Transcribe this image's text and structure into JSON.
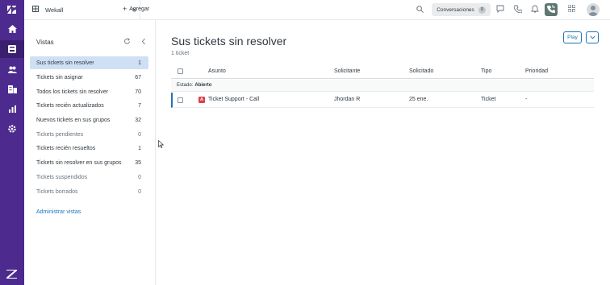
{
  "topbar": {
    "tab_title": "Wekall",
    "tab_close": "×",
    "add_label": "Agregar",
    "add_plus": "+",
    "conversations_label": "Conversaciones",
    "conversations_count": "0"
  },
  "views": {
    "title": "Vistas",
    "items": [
      {
        "label": "Sus tickets sin resolver",
        "count": "1"
      },
      {
        "label": "Tickets sin asignar",
        "count": "67"
      },
      {
        "label": "Todos los tickets sin resolver",
        "count": "70"
      },
      {
        "label": "Tickets recién actualizados",
        "count": "7"
      },
      {
        "label": "Nuevos tickets en sus grupos",
        "count": "32"
      },
      {
        "label": "Tickets pendientes",
        "count": "0"
      },
      {
        "label": "Tickets recién resueltos",
        "count": "1"
      },
      {
        "label": "Tickets sin resolver en sus grupos",
        "count": "35"
      },
      {
        "label": "Tickets suspendidos",
        "count": "0"
      },
      {
        "label": "Tickets borrados",
        "count": "0"
      }
    ],
    "manage_label": "Administrar vistas"
  },
  "main": {
    "title": "Sus tickets sin resolver",
    "count_text": "1 ticket",
    "play_label": "Play",
    "columns": {
      "subject": "Asunto",
      "requester": "Solicitante",
      "requested": "Solicitado",
      "type": "Tipo",
      "priority": "Prioridad"
    },
    "group": {
      "label": "Estado:",
      "value": "Abierto"
    },
    "rows": [
      {
        "badge": "A",
        "subject": "Ticket Support - Call",
        "requester": "Jhordan R",
        "requested": "25 ene.",
        "type": "Ticket",
        "priority": "-"
      }
    ]
  },
  "colors": {
    "rail": "#4d2a8e",
    "accent": "#1f73b7",
    "active_view": "#cfe0f5",
    "open_badge": "#d93f4c"
  },
  "icons": [
    "zendesk-logo-icon",
    "home-icon",
    "views-icon",
    "customers-icon",
    "organizations-icon",
    "reporting-icon",
    "admin-gear-icon",
    "zendesk-z-icon",
    "search-icon",
    "chat-icon",
    "phone-icon",
    "bell-icon",
    "talk-active-icon",
    "apps-grid-icon",
    "avatar-icon",
    "refresh-icon",
    "collapse-icon",
    "chevron-down-icon"
  ]
}
